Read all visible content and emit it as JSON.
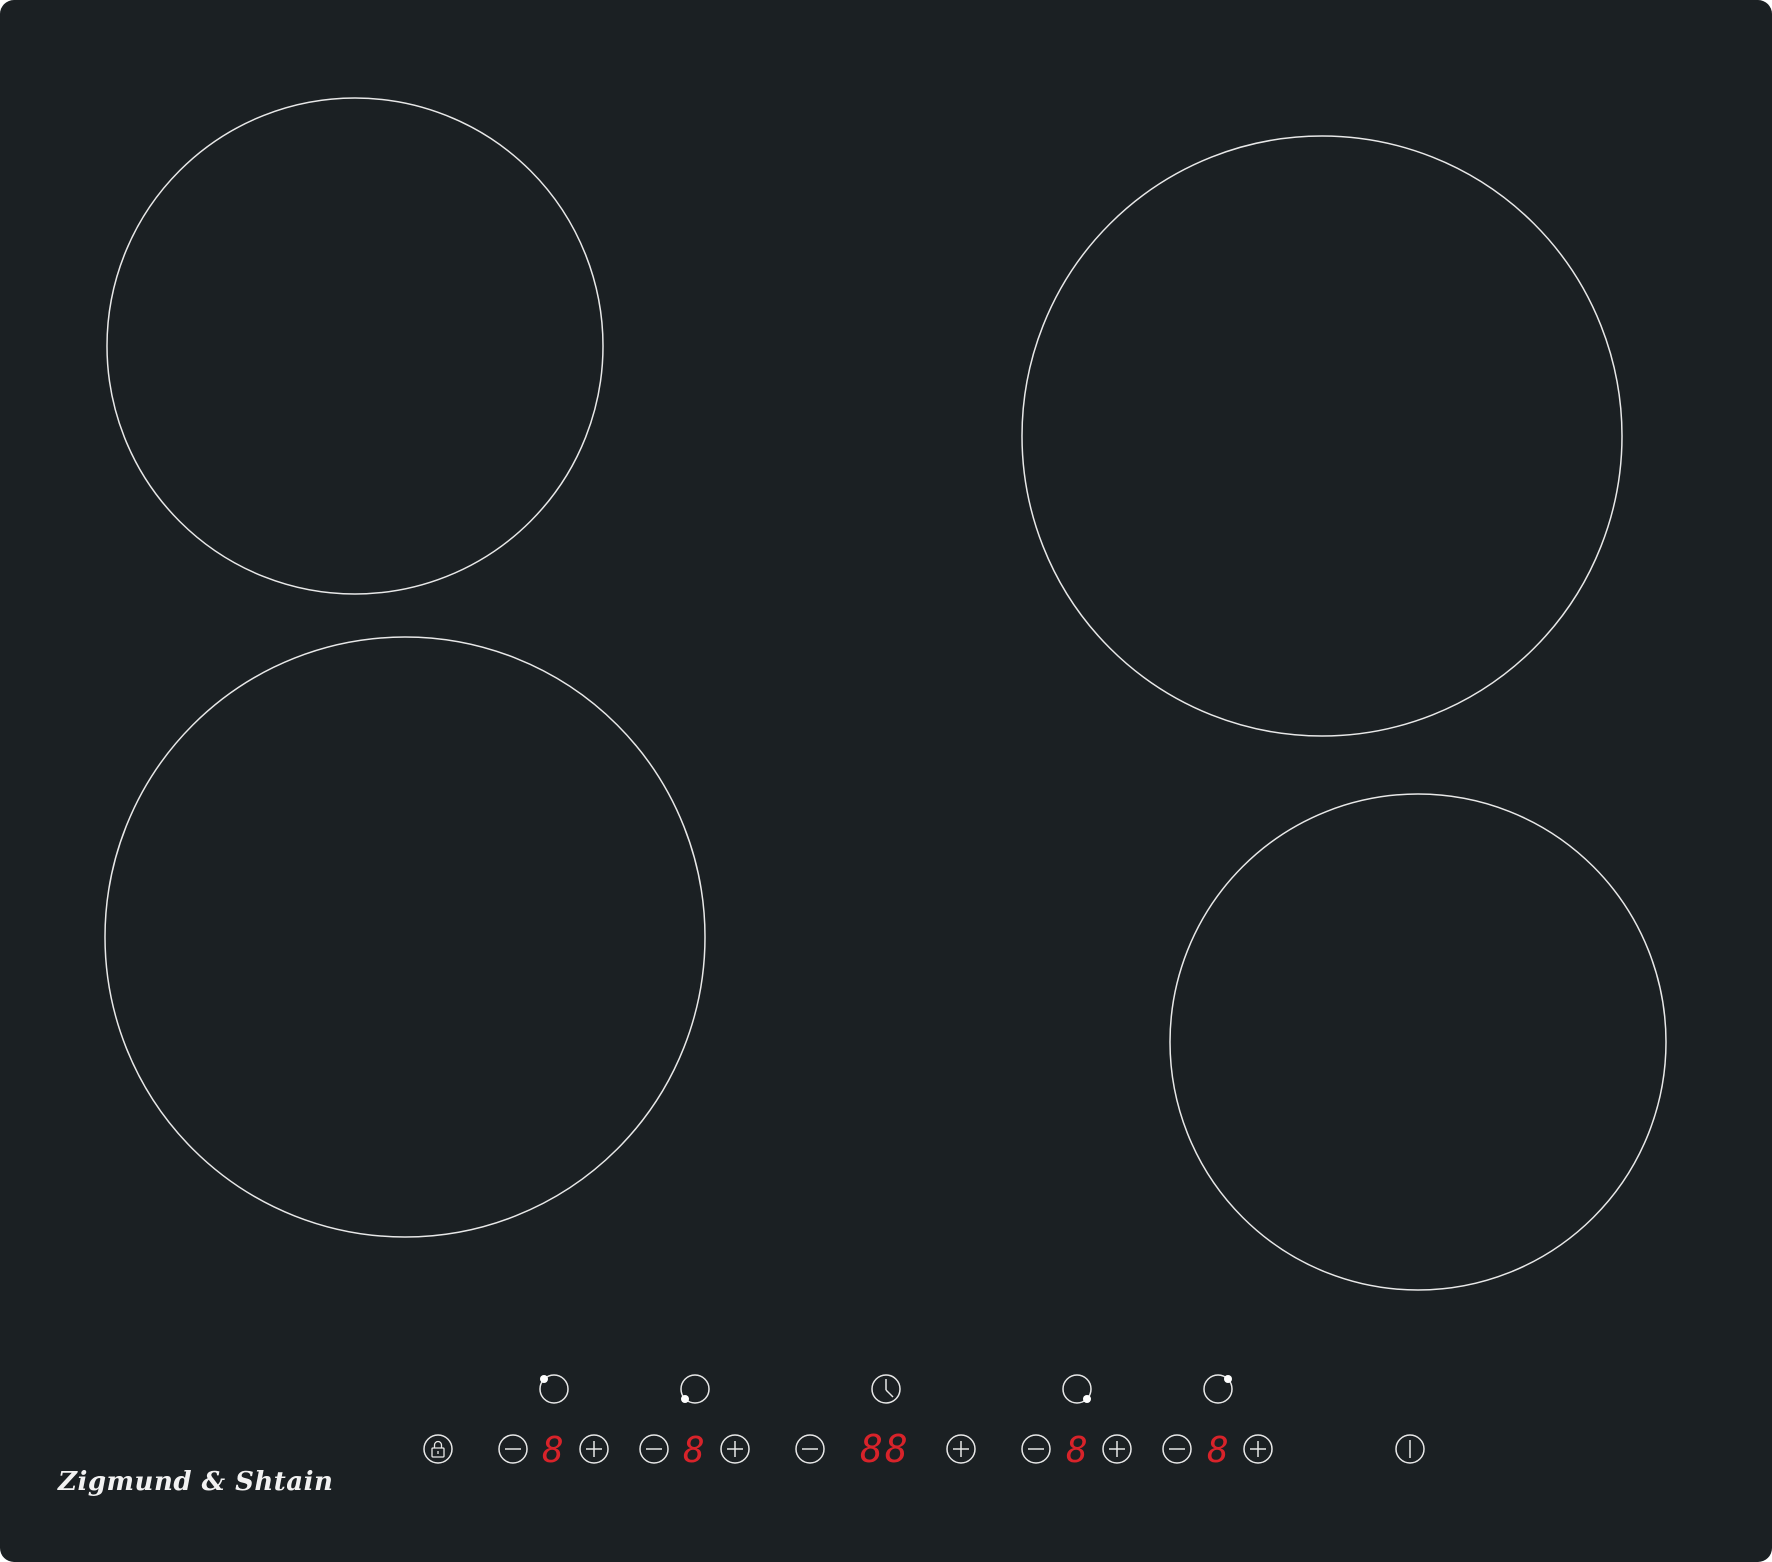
{
  "brand": {
    "name": "Zigmund & Shtain"
  },
  "colors": {
    "glass": "#1b2023",
    "outline": "#e8e8e8",
    "led": "#d8232a"
  },
  "zones": [
    {
      "id": "rear-left",
      "icon": "zone-rear-left-icon",
      "level": "8"
    },
    {
      "id": "front-left",
      "icon": "zone-front-left-icon",
      "level": "8"
    },
    {
      "id": "front-right",
      "icon": "zone-front-right-icon",
      "level": "8"
    },
    {
      "id": "rear-right",
      "icon": "zone-rear-right-icon",
      "level": "8"
    }
  ],
  "timer": {
    "icon": "clock-icon",
    "value": "88"
  },
  "controls": {
    "lock_icon": "lock-icon",
    "power_icon": "power-icon",
    "minus_icon": "minus-icon",
    "plus_icon": "plus-icon"
  }
}
